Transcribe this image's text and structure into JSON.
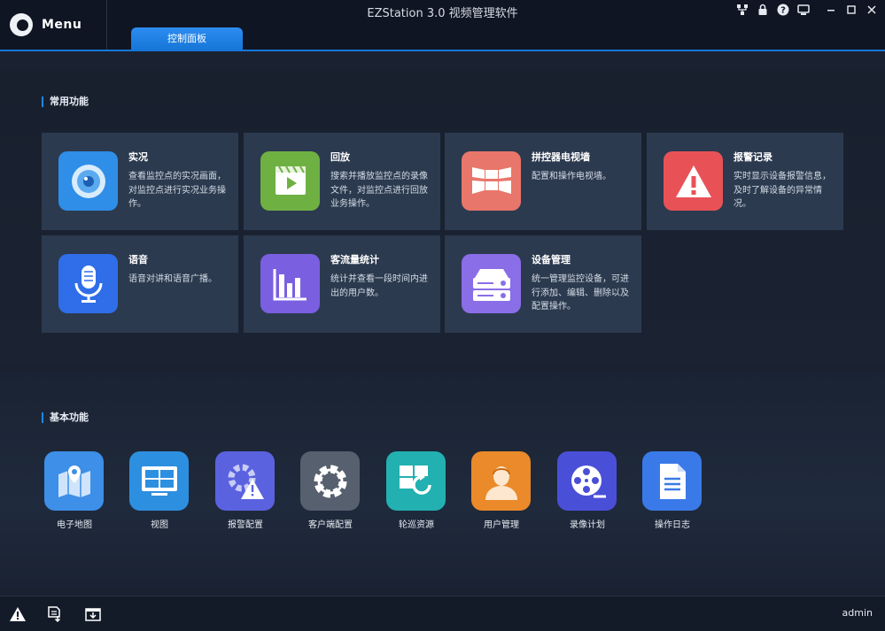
{
  "menu": {
    "label": "Menu"
  },
  "window": {
    "title": "EZStation 3.0 视频管理软件"
  },
  "tabs": [
    {
      "label": "控制面板",
      "active": true
    }
  ],
  "common": {
    "title": "常用功能",
    "cards": [
      {
        "title": "实况",
        "desc": "查看监控点的实况画面，对监控点进行实况业务操作。",
        "icon": "camera-lens-icon",
        "color": "#2f8ee8"
      },
      {
        "title": "回放",
        "desc": "搜索并播放监控点的录像文件，对监控点进行回放业务操作。",
        "icon": "clapperboard-play-icon",
        "color": "#6fb043"
      },
      {
        "title": "拼控器电视墙",
        "desc": "配置和操作电视墙。",
        "icon": "video-wall-icon",
        "color": "#e8766a"
      },
      {
        "title": "报警记录",
        "desc": "实时显示设备报警信息，及时了解设备的异常情况。",
        "icon": "warning-triangle-icon",
        "color": "#e85257"
      },
      {
        "title": "语音",
        "desc": "语音对讲和语音广播。",
        "icon": "microphone-icon",
        "color": "#2f6ee8"
      },
      {
        "title": "客流量统计",
        "desc": "统计并查看一段时间内进出的用户数。",
        "icon": "bar-chart-icon",
        "color": "#7a5fe0"
      },
      {
        "title": "设备管理",
        "desc": "统一管理监控设备，可进行添加、编辑、删除以及配置操作。",
        "icon": "server-device-icon",
        "color": "#8a6ee8"
      }
    ]
  },
  "basic": {
    "title": "基本功能",
    "tiles": [
      {
        "label": "电子地图",
        "icon": "map-pin-icon",
        "color": "#3d8fe8"
      },
      {
        "label": "视图",
        "icon": "monitor-grid-icon",
        "color": "#2d8fe0"
      },
      {
        "label": "报警配置",
        "icon": "gear-alarm-icon",
        "color": "#5a62e0"
      },
      {
        "label": "客户端配置",
        "icon": "gear-icon",
        "color": "#56606e"
      },
      {
        "label": "轮巡资源",
        "icon": "patrol-rotate-icon",
        "color": "#23b0b0"
      },
      {
        "label": "用户管理",
        "icon": "user-icon",
        "color": "#ea8a2a"
      },
      {
        "label": "录像计划",
        "icon": "film-reel-icon",
        "color": "#4a4fd8"
      },
      {
        "label": "操作日志",
        "icon": "document-icon",
        "color": "#3a7ae8"
      }
    ]
  },
  "statusbar": {
    "user": "admin"
  }
}
